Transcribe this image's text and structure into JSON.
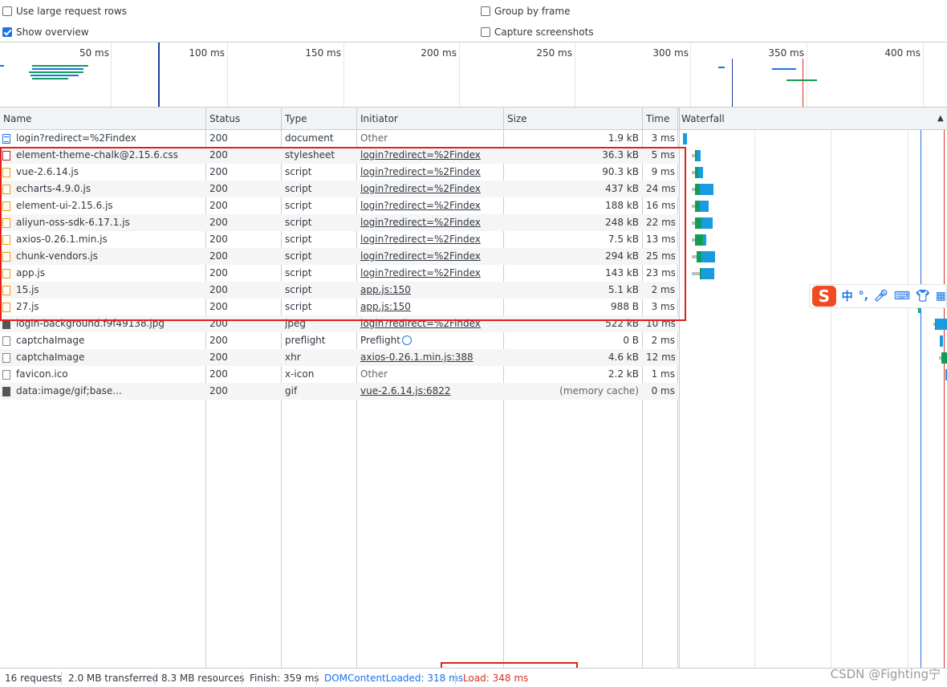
{
  "options": {
    "large_rows": {
      "label": "Use large request rows",
      "checked": false
    },
    "show_overview": {
      "label": "Show overview",
      "checked": true
    },
    "group_by_frame": {
      "label": "Group by frame",
      "checked": false
    },
    "capture_screenshots": {
      "label": "Capture screenshots",
      "checked": false
    }
  },
  "overview": {
    "ticks": [
      "50 ms",
      "100 ms",
      "150 ms",
      "200 ms",
      "250 ms",
      "300 ms",
      "350 ms",
      "400 ms"
    ]
  },
  "columns": {
    "name": "Name",
    "status": "Status",
    "type": "Type",
    "initiator": "Initiator",
    "size": "Size",
    "time": "Time",
    "waterfall": "Waterfall"
  },
  "requests": [
    {
      "name": "login?redirect=%2Findex",
      "status": "200",
      "type": "document",
      "initiator": "Other",
      "initiator_link": false,
      "size": "1.9 kB",
      "time": "3 ms",
      "icon": "document-icon"
    },
    {
      "name": "element-theme-chalk@2.15.6.css",
      "status": "200",
      "type": "stylesheet",
      "initiator": "login?redirect=%2Findex",
      "initiator_link": true,
      "size": "36.3 kB",
      "time": "5 ms",
      "icon": "stylesheet-icon"
    },
    {
      "name": "vue-2.6.14.js",
      "status": "200",
      "type": "script",
      "initiator": "login?redirect=%2Findex",
      "initiator_link": true,
      "size": "90.3 kB",
      "time": "9 ms",
      "icon": "script-icon"
    },
    {
      "name": "echarts-4.9.0.js",
      "status": "200",
      "type": "script",
      "initiator": "login?redirect=%2Findex",
      "initiator_link": true,
      "size": "437 kB",
      "time": "24 ms",
      "icon": "script-icon"
    },
    {
      "name": "element-ui-2.15.6.js",
      "status": "200",
      "type": "script",
      "initiator": "login?redirect=%2Findex",
      "initiator_link": true,
      "size": "188 kB",
      "time": "16 ms",
      "icon": "script-icon"
    },
    {
      "name": "aliyun-oss-sdk-6.17.1.js",
      "status": "200",
      "type": "script",
      "initiator": "login?redirect=%2Findex",
      "initiator_link": true,
      "size": "248 kB",
      "time": "22 ms",
      "icon": "script-icon"
    },
    {
      "name": "axios-0.26.1.min.js",
      "status": "200",
      "type": "script",
      "initiator": "login?redirect=%2Findex",
      "initiator_link": true,
      "size": "7.5 kB",
      "time": "13 ms",
      "icon": "script-icon"
    },
    {
      "name": "chunk-vendors.js",
      "status": "200",
      "type": "script",
      "initiator": "login?redirect=%2Findex",
      "initiator_link": true,
      "size": "294 kB",
      "time": "25 ms",
      "icon": "script-icon"
    },
    {
      "name": "app.js",
      "status": "200",
      "type": "script",
      "initiator": "login?redirect=%2Findex",
      "initiator_link": true,
      "size": "143 kB",
      "time": "23 ms",
      "icon": "script-icon"
    },
    {
      "name": "15.js",
      "status": "200",
      "type": "script",
      "initiator": "app.js:150",
      "initiator_link": true,
      "size": "5.1 kB",
      "time": "2 ms",
      "icon": "script-icon"
    },
    {
      "name": "27.js",
      "status": "200",
      "type": "script",
      "initiator": "app.js:150",
      "initiator_link": true,
      "size": "988 B",
      "time": "3 ms",
      "icon": "script-icon"
    },
    {
      "name": "login-background.f9f49138.jpg",
      "status": "200",
      "type": "jpeg",
      "initiator": "login?redirect=%2Findex",
      "initiator_link": true,
      "size": "522 kB",
      "time": "10 ms",
      "icon": "image-icon"
    },
    {
      "name": "captchaImage",
      "status": "200",
      "type": "preflight",
      "initiator": "Preflight",
      "initiator_link": false,
      "size": "0 B",
      "time": "2 ms",
      "icon": "fetch-icon"
    },
    {
      "name": "captchaImage",
      "status": "200",
      "type": "xhr",
      "initiator": "axios-0.26.1.min.js:388",
      "initiator_link": true,
      "size": "4.6 kB",
      "time": "12 ms",
      "icon": "fetch-icon"
    },
    {
      "name": "favicon.ico",
      "status": "200",
      "type": "x-icon",
      "initiator": "Other",
      "initiator_link": false,
      "size": "2.2 kB",
      "time": "1 ms",
      "icon": "fetch-icon"
    },
    {
      "name": "data:image/gif;base...",
      "status": "200",
      "type": "gif",
      "initiator": "vue-2.6.14.js:6822",
      "initiator_link": true,
      "size": "(memory cache)",
      "time": "0 ms",
      "icon": "image-icon"
    }
  ],
  "status_bar": {
    "requests": "16 requests",
    "transferred": "2.0 MB transferred",
    "resources": "8.3 MB resources",
    "finish": "Finish: 359 ms",
    "dom_content_loaded": "DOMContentLoaded: 318 ms",
    "load": "Load: 348 ms"
  },
  "ime": {
    "logo": "S",
    "lang": "中",
    "punct": "°,"
  },
  "watermark": "CSDN @Fighting宁",
  "colors": {
    "dom_loaded": "#1a73e8",
    "load": "#d93025",
    "highlight": "#e02020"
  }
}
